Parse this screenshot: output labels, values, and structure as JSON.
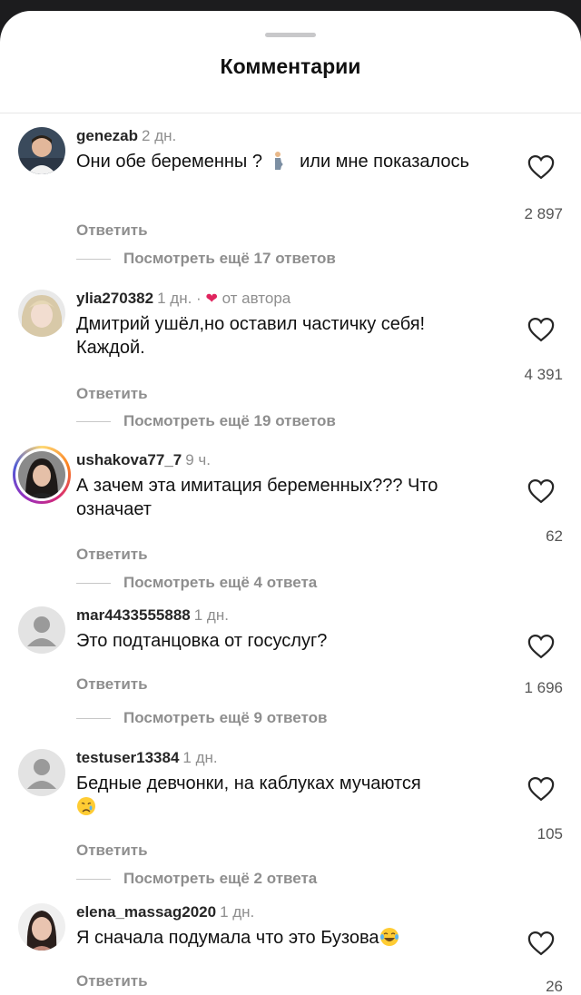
{
  "header": {
    "title": "Комментарии"
  },
  "comments": [
    {
      "username": "genezab",
      "time": "2 дн.",
      "text": "Они обе беременны ? 🤰 или мне показалось",
      "text_a": "Они обе беременны ?",
      "text_b": "или мне показалось",
      "emoji": "pregnant-woman-emoji",
      "reply": "Ответить",
      "more": "Посмотреть ещё 17 ответов",
      "likes": "2 897"
    },
    {
      "username": "ylia270382",
      "time": "1 дн.",
      "author_dot": "·",
      "author_label": "от автора",
      "text": "Дмитрий ушёл,но оставил частичку себя! Каждой.",
      "reply": "Ответить",
      "more": "Посмотреть ещё 19 ответов",
      "likes": "4 391"
    },
    {
      "username": "ushakova77_7",
      "time": "9 ч.",
      "text": "А зачем эта имитация беременных??? Что означает",
      "reply": "Ответить",
      "more": "Посмотреть ещё 4 ответа",
      "likes": "62"
    },
    {
      "username": "mar4433555888",
      "time": "1 дн.",
      "text": "Это подтанцовка от госуслуг?",
      "reply": "Ответить",
      "more": "Посмотреть ещё 9 ответов",
      "likes": "1 696"
    },
    {
      "username": "testuser13384",
      "time": "1 дн.",
      "text": "Бедные девчонки, на каблуках мучаются",
      "emoji": "crying-face-emoji",
      "reply": "Ответить",
      "more": "Посмотреть ещё 2 ответа",
      "likes": "105"
    },
    {
      "username": "elena_massag2020",
      "time": "1 дн.",
      "text": "Я сначала подумала что это Бузова",
      "emoji": "tears-of-joy-emoji",
      "reply": "Ответить",
      "likes": "26"
    }
  ],
  "colors": {
    "accent_like": "#e0245e",
    "muted": "#8e8e8e"
  }
}
